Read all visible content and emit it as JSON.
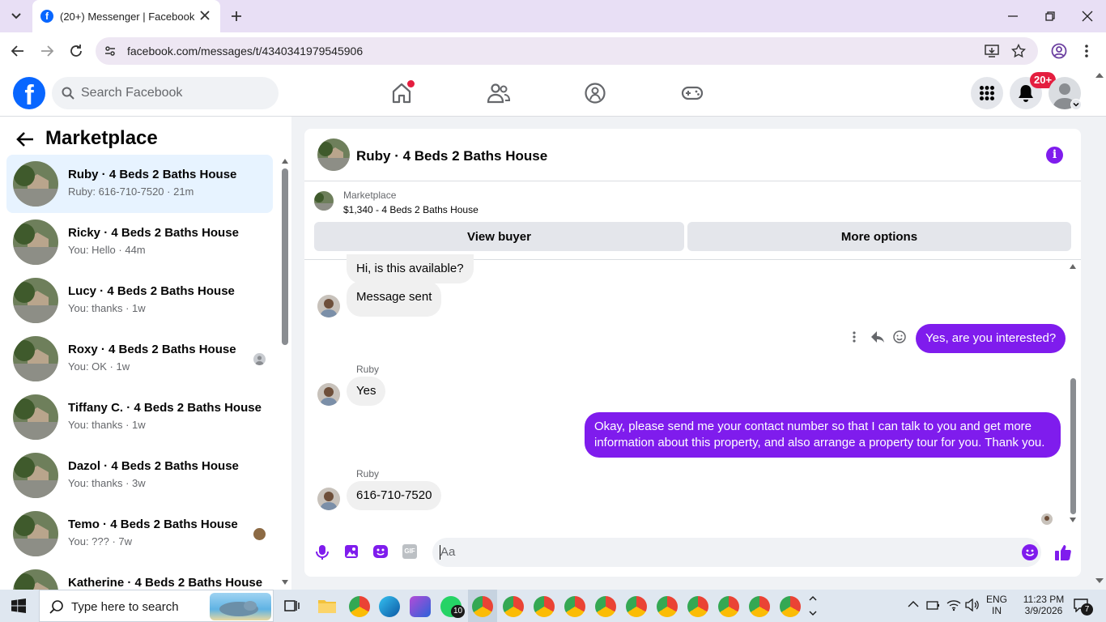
{
  "browser": {
    "tab_title": "(20+) Messenger | Facebook",
    "url": "facebook.com/messages/t/4340341979545906"
  },
  "header": {
    "search_placeholder": "Search Facebook",
    "notification_badge": "20+"
  },
  "sidebar": {
    "title": "Marketplace",
    "conversations": [
      {
        "name": "Ruby · 4 Beds 2 Baths House",
        "preview": "Ruby: 616-710-7520 · 21m",
        "active": true
      },
      {
        "name": "Ricky · 4 Beds 2 Baths House",
        "preview": "You: Hello · 44m"
      },
      {
        "name": "Lucy · 4 Beds 2 Baths House",
        "preview": "You: thanks · 1w"
      },
      {
        "name": "Roxy · 4 Beds 2 Baths House",
        "preview": "You: OK · 1w"
      },
      {
        "name": "Tiffany C. · 4 Beds 2 Baths House",
        "preview": "You: thanks · 1w"
      },
      {
        "name": "Dazol · 4 Beds 2 Baths House",
        "preview": "You: thanks · 3w"
      },
      {
        "name": "Temo · 4 Beds 2 Baths House",
        "preview": "You: ??? · 7w"
      },
      {
        "name": "Katherine · 4 Beds 2 Baths House",
        "preview": ""
      }
    ]
  },
  "chat": {
    "title": "Ruby · 4 Beds 2 Baths House",
    "listing_source": "Marketplace",
    "listing_title": "$1,340 - 4 Beds 2 Baths House",
    "view_buyer_label": "View buyer",
    "more_options_label": "More options",
    "messages": [
      {
        "from": "",
        "text": "Hi, is this available?"
      },
      {
        "from": "",
        "text": "Message sent"
      },
      {
        "from": "You",
        "text": "Yes, are you interested?"
      },
      {
        "from": "Ruby",
        "text": "Yes"
      },
      {
        "from": "You",
        "text": "Okay, please send me your contact number so that I can talk to you and get more information about this property, and also arrange a property tour for you. Thank you."
      },
      {
        "from": "Ruby",
        "text": "616-710-7520"
      }
    ],
    "composer_placeholder": "Aa",
    "accent_color": "#7f1ced"
  },
  "taskbar": {
    "search_placeholder": "Type here to search",
    "whatsapp_badge": "10",
    "lang_primary": "ENG",
    "lang_secondary": "IN",
    "time": "11:23 PM",
    "date": "3/9/2026",
    "notification_count": "7"
  }
}
